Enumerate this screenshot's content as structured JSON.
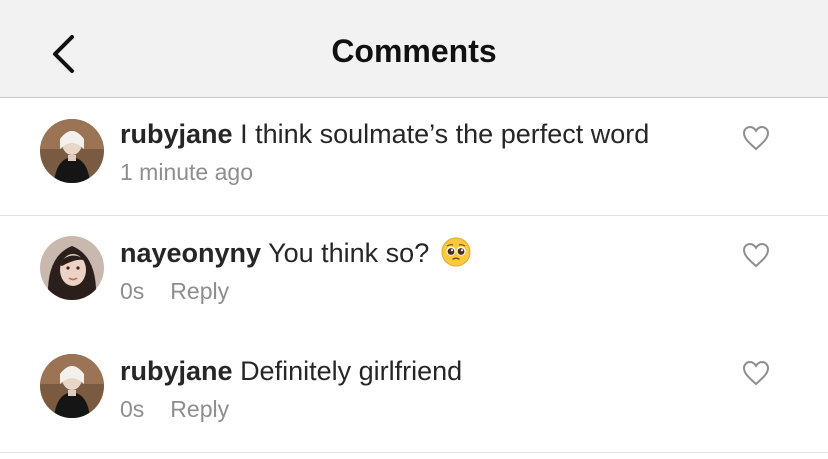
{
  "header": {
    "title": "Comments",
    "back_icon": "chevron-left-icon"
  },
  "colors": {
    "header_bg": "#f2f2f2",
    "text": "#262626",
    "meta": "#8e8e8e",
    "divider": "#e3e3e3"
  },
  "comments": [
    {
      "username": "rubyjane",
      "text": "I think soulmate’s the perfect word",
      "time": "1 minute ago",
      "reply_label": ""
    },
    {
      "username": "nayeonyny",
      "text": "You think so?",
      "emoji": "pleading-face-emoji",
      "time": "0s",
      "reply_label": "Reply"
    },
    {
      "username": "rubyjane",
      "text": "Definitely girlfriend",
      "time": "0s",
      "reply_label": "Reply"
    }
  ]
}
